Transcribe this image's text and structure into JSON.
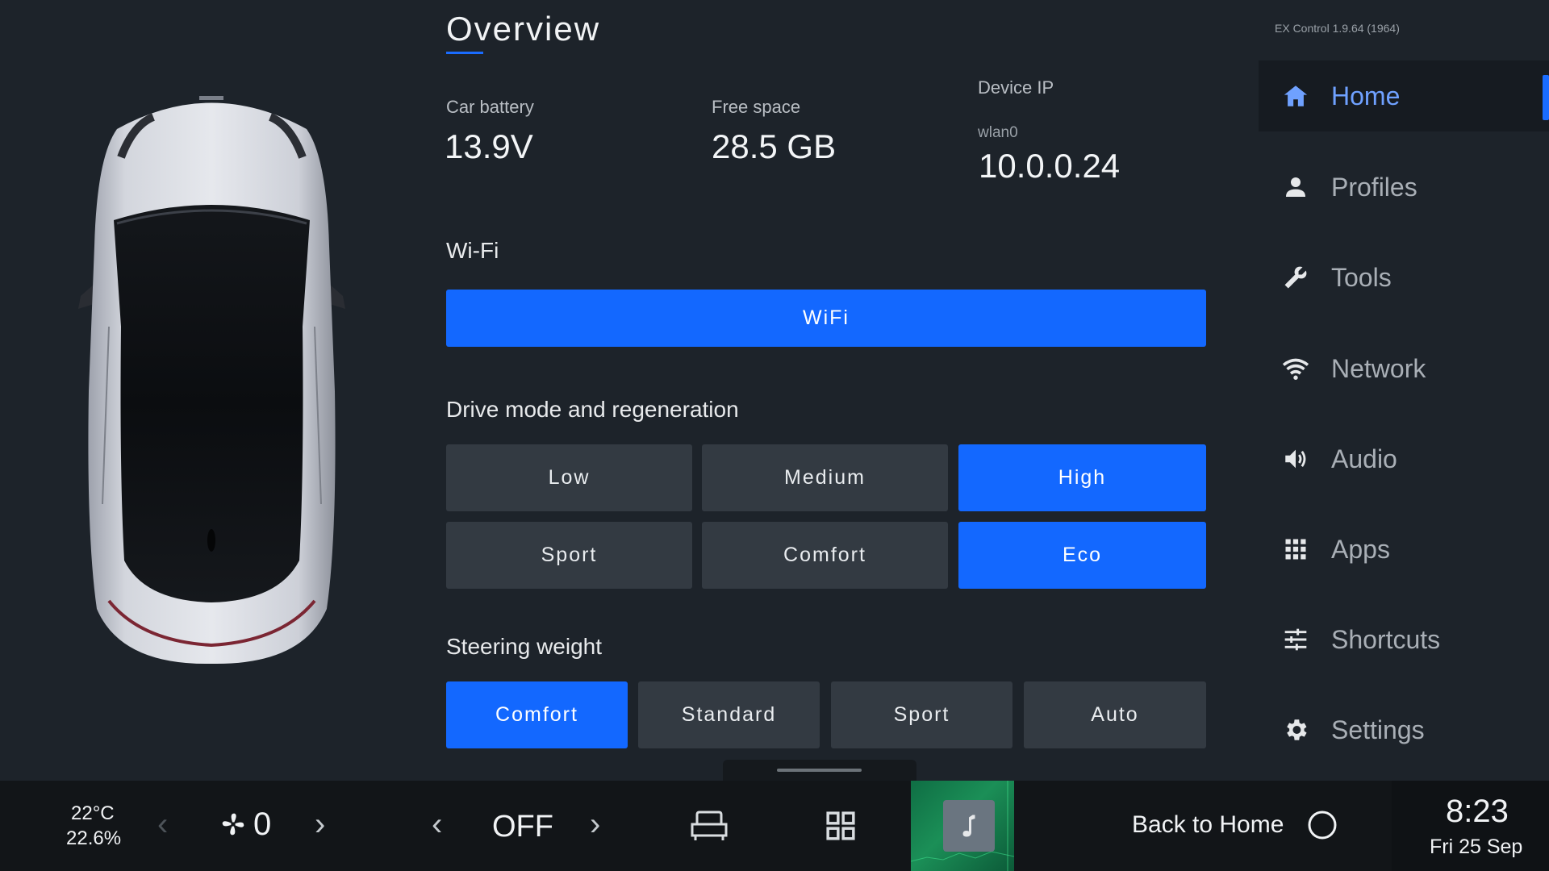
{
  "header": {
    "title": "Overview",
    "version": "EX Control 1.9.64 (1964)"
  },
  "stats": {
    "car_battery": {
      "label": "Car battery",
      "value": "13.9V"
    },
    "free_space": {
      "label": "Free space",
      "value": "28.5 GB"
    },
    "device_ip": {
      "label": "Device IP",
      "interface": "wlan0",
      "value": "10.0.0.24"
    }
  },
  "wifi": {
    "section_title": "Wi-Fi",
    "button_label": "WiFi"
  },
  "drive": {
    "section_title": "Drive mode and regeneration",
    "regen_options": [
      "Low",
      "Medium",
      "High"
    ],
    "regen_selected": "High",
    "mode_options": [
      "Sport",
      "Comfort",
      "Eco"
    ],
    "mode_selected": "Eco"
  },
  "steering": {
    "section_title": "Steering weight",
    "options": [
      "Comfort",
      "Standard",
      "Sport",
      "Auto"
    ],
    "selected": "Comfort"
  },
  "sidebar": {
    "items": [
      {
        "label": "Home",
        "icon": "home-icon",
        "active": true
      },
      {
        "label": "Profiles",
        "icon": "person-icon",
        "active": false
      },
      {
        "label": "Tools",
        "icon": "wrench-icon",
        "active": false
      },
      {
        "label": "Network",
        "icon": "wifi-icon",
        "active": false
      },
      {
        "label": "Audio",
        "icon": "speaker-icon",
        "active": false
      },
      {
        "label": "Apps",
        "icon": "grid-icon",
        "active": false
      },
      {
        "label": "Shortcuts",
        "icon": "sliders-icon",
        "active": false
      },
      {
        "label": "Settings",
        "icon": "gear-icon",
        "active": false
      }
    ]
  },
  "bottom_bar": {
    "temperature": "22°C",
    "humidity": "22.6%",
    "fan_speed": "0",
    "ac_status": "OFF",
    "back_to_home": "Back to Home",
    "time": "8:23",
    "date": "Fri 25 Sep"
  },
  "colors": {
    "accent": "#1368ff",
    "background": "#1d232a",
    "button": "#333a42",
    "bottom_bar": "#121518"
  }
}
